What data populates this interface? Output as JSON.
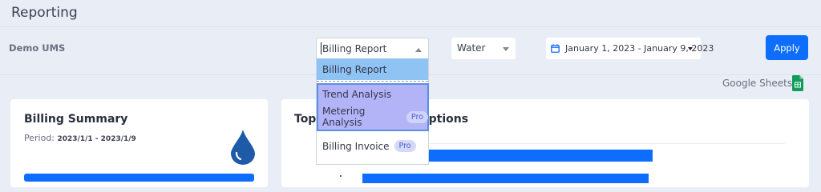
{
  "page": {
    "title": "Reporting"
  },
  "org": {
    "name": "Demo UMS"
  },
  "filters": {
    "report_type": {
      "value": "Billing Report",
      "options": [
        {
          "label": "Billing Report",
          "pro": ""
        },
        {
          "label": "Trend Analysis",
          "pro": ""
        },
        {
          "label": "Metering Analysis",
          "pro": "Pro"
        },
        {
          "label": "Billing Invoice",
          "pro": "Pro"
        }
      ]
    },
    "utility": {
      "value": "Water"
    },
    "date_range": {
      "value": "January 1, 2023 - January 9, 2023"
    },
    "apply_label": "Apply"
  },
  "export": {
    "google_sheets_label": "Google Sheets"
  },
  "cards": {
    "billing_summary": {
      "title": "Billing Summary",
      "period_label": "Period:",
      "period_value": "2023/1/1 - 2023/1/9"
    },
    "top_consumptions": {
      "title_start": "Top",
      "title_end": "options"
    }
  },
  "colors": {
    "accent": "#0d6efd",
    "selected_option": "#8fc3f4",
    "highlight_group": "#b3b3f8",
    "pro_badge_text": "#4a61d8"
  },
  "icons": {
    "calendar": "calendar-icon",
    "google_sheets": "google-sheets-icon",
    "water_drop": "water-drop-icon"
  }
}
